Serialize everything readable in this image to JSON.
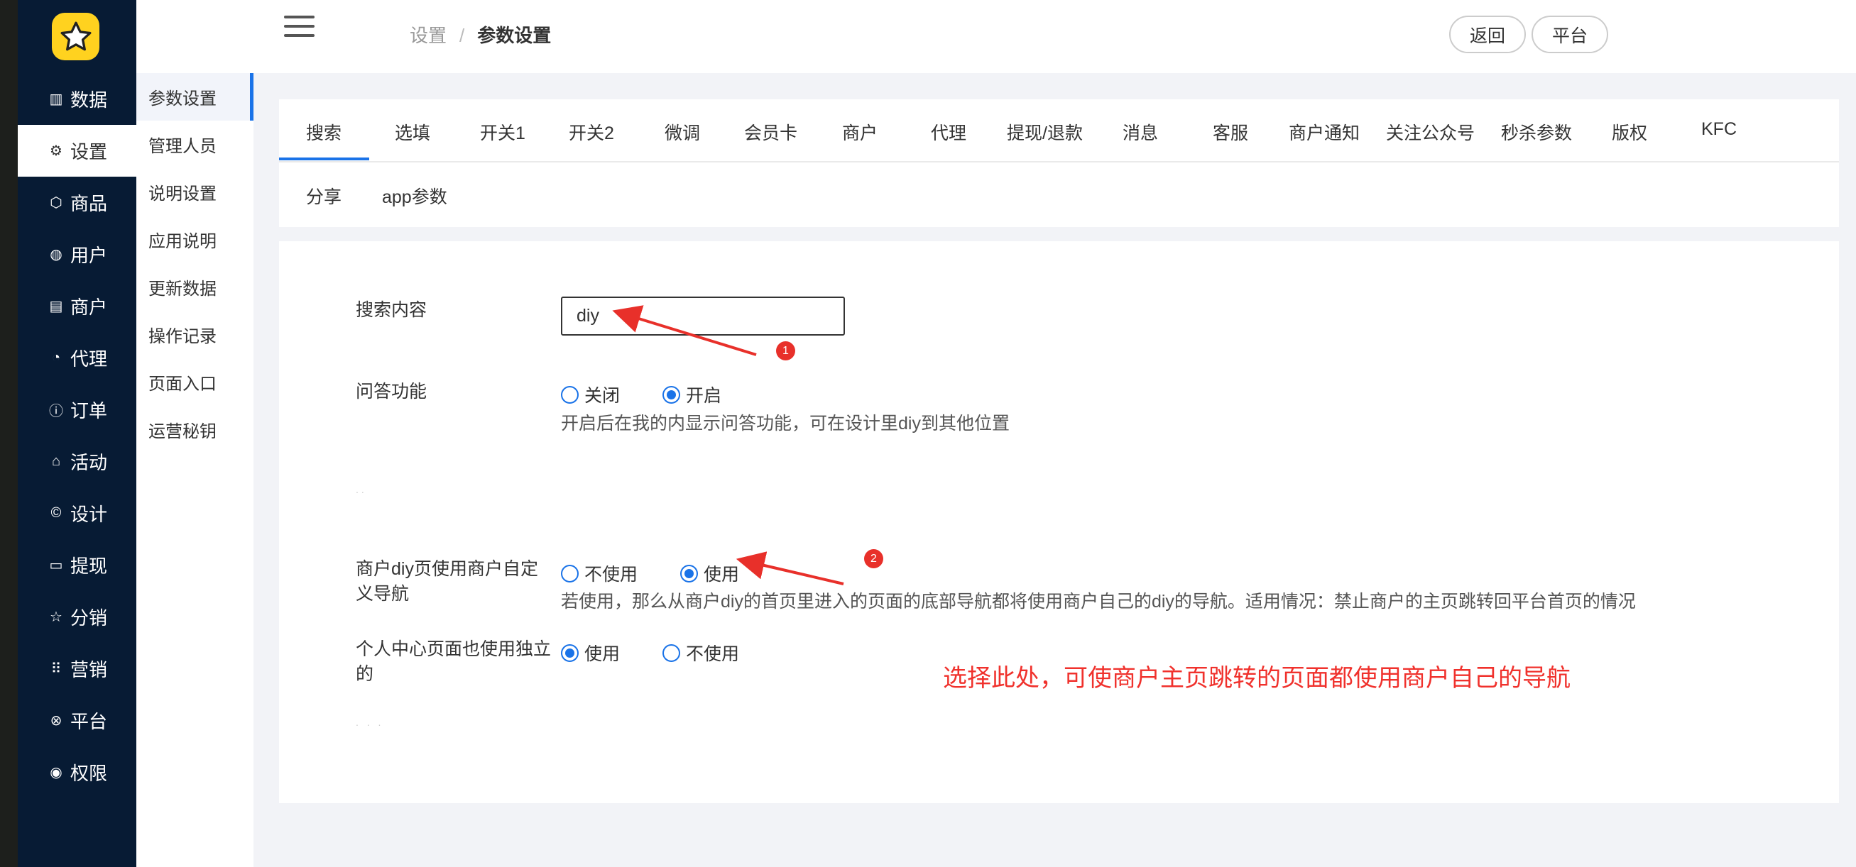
{
  "colors": {
    "accent": "#1a73e8",
    "sidebar_bg": "#071b34",
    "logo_bg": "#ffd21f",
    "annotation": "#f0312c"
  },
  "sidebar": {
    "items": [
      {
        "label": "数据",
        "icon": "chart-icon"
      },
      {
        "label": "设置",
        "icon": "gear-icon",
        "active": true
      },
      {
        "label": "商品",
        "icon": "box-icon"
      },
      {
        "label": "用户",
        "icon": "user-icon"
      },
      {
        "label": "商户",
        "icon": "list-icon"
      },
      {
        "label": "代理",
        "icon": "clock-icon"
      },
      {
        "label": "订单",
        "icon": "info-icon"
      },
      {
        "label": "活动",
        "icon": "tag-icon"
      },
      {
        "label": "设计",
        "icon": "copyright-icon"
      },
      {
        "label": "提现",
        "icon": "card-icon"
      },
      {
        "label": "分销",
        "icon": "star-icon"
      },
      {
        "label": "营销",
        "icon": "grid-icon"
      },
      {
        "label": "平台",
        "icon": "xbox-icon"
      },
      {
        "label": "权限",
        "icon": "compass-icon"
      }
    ]
  },
  "subnav": {
    "items": [
      "参数设置",
      "管理人员",
      "说明设置",
      "应用说明",
      "更新数据",
      "操作记录",
      "页面入口",
      "运营秘钥"
    ]
  },
  "header": {
    "breadcrumb_parent": "设置",
    "breadcrumb_sep": "/",
    "breadcrumb_current": "参数设置",
    "back_label": "返回",
    "platform_label": "平台"
  },
  "tabs": {
    "row1": [
      "搜索",
      "选填",
      "开关1",
      "开关2",
      "微调",
      "会员卡",
      "商户",
      "代理",
      "提现/退款",
      "消息",
      "客服",
      "商户通知",
      "关注公众号",
      "秒杀参数",
      "版权",
      "KFC"
    ],
    "row2": [
      "分享",
      "app参数"
    ]
  },
  "form": {
    "search_label": "搜索内容",
    "search_value": "diy",
    "qa_label": "问答功能",
    "qa_off": "关闭",
    "qa_on": "开启",
    "qa_hint": "开启后在我的内显示问答功能，可在设计里diy到其他位置",
    "merchant_nav_label": "商户diy页使用商户自定义导航",
    "merchant_nav_off": "不使用",
    "merchant_nav_on": "使用",
    "merchant_nav_hint": "若使用，那么从商户diy的首页里进入的页面的底部导航都将使用商户自己的diy的导航。适用情况：禁止商户的主页跳转回平台首页的情况",
    "personal_label": "个人中心页面也使用独立的",
    "personal_on": "使用",
    "personal_off": "不使用"
  },
  "annotations": {
    "note": "选择此处，可使商户主页跳转的页面都使用商户自己的导航",
    "marker1": "1",
    "marker2": "2"
  }
}
